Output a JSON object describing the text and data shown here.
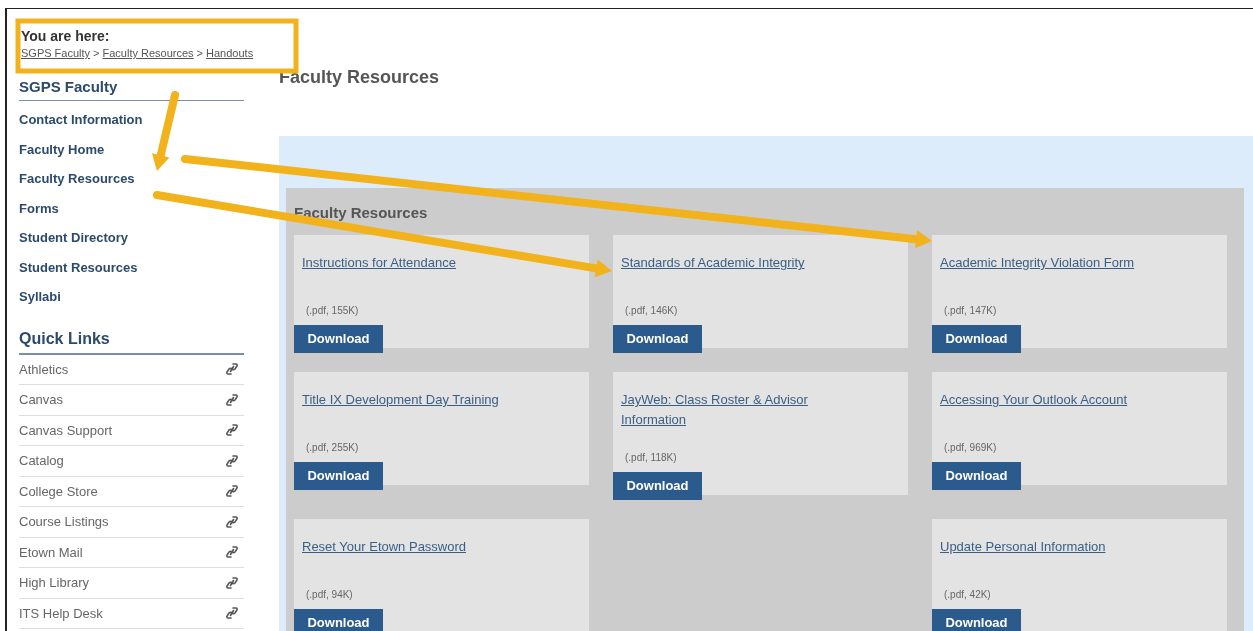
{
  "breadcrumb": {
    "label": "You are here:",
    "items": [
      {
        "text": "SGPS Faculty"
      },
      {
        "text": "Faculty Resources"
      },
      {
        "text": "Handouts"
      }
    ],
    "separator": ">"
  },
  "sidebar": {
    "heading": "SGPS Faculty",
    "items": [
      {
        "label": "Contact Information"
      },
      {
        "label": "Faculty Home"
      },
      {
        "label": "Faculty Resources"
      },
      {
        "label": "Forms"
      },
      {
        "label": "Student Directory"
      },
      {
        "label": "Student Resources"
      },
      {
        "label": "Syllabi"
      }
    ]
  },
  "quick_links": {
    "heading": "Quick Links",
    "items": [
      {
        "label": "Athletics"
      },
      {
        "label": "Canvas"
      },
      {
        "label": "Canvas Support"
      },
      {
        "label": "Catalog"
      },
      {
        "label": "College Store"
      },
      {
        "label": "Course Listings"
      },
      {
        "label": "Etown Mail"
      },
      {
        "label": "High Library"
      },
      {
        "label": "ITS Help Desk"
      }
    ]
  },
  "page_title": "Faculty Resources",
  "resources": {
    "heading": "Faculty Resources",
    "cards": [
      {
        "title": "Instructions for Attendance",
        "info": "(.pdf, 155K)",
        "button": "Download"
      },
      {
        "title": "Standards of Academic Integrity",
        "info": "(.pdf, 146K)",
        "button": "Download"
      },
      {
        "title": "Academic Integrity Violation Form",
        "info": "(.pdf, 147K)",
        "button": "Download"
      },
      {
        "title": "Title IX Development Day Training",
        "info": "(.pdf, 255K)",
        "button": "Download"
      },
      {
        "title": "JayWeb: Class Roster & Advisor Information",
        "info": "(.pdf, 118K)",
        "button": "Download"
      },
      {
        "title": "Accessing Your Outlook Account",
        "info": "(.pdf, 969K)",
        "button": "Download"
      },
      {
        "title": "Reset Your Etown Password",
        "info": "(.pdf, 94K)",
        "button": "Download"
      },
      {
        "kind": "empty"
      },
      {
        "title": "Update Personal Information",
        "info": "(.pdf, 42K)",
        "button": "Download"
      }
    ]
  }
}
